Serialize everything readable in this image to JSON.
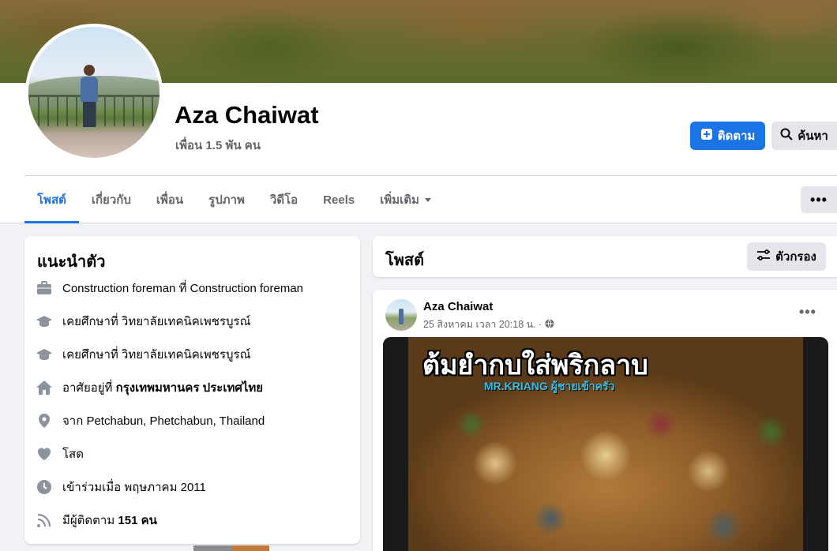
{
  "profile": {
    "name": "Aza Chaiwat",
    "friends": "เพื่อน 1.5 พัน คน"
  },
  "actions": {
    "follow_label": "ติดตาม",
    "search_label": "ค้นหา",
    "more_label": "•••"
  },
  "tabs": [
    {
      "label": "โพสต์",
      "active": true
    },
    {
      "label": "เกี่ยวกับ",
      "active": false
    },
    {
      "label": "เพื่อน",
      "active": false
    },
    {
      "label": "รูปภาพ",
      "active": false
    },
    {
      "label": "วิดีโอ",
      "active": false
    },
    {
      "label": "Reels",
      "active": false
    },
    {
      "label": "เพิ่มเติม",
      "active": false
    }
  ],
  "intro": {
    "title": "แนะนำตัว",
    "items": [
      {
        "icon": "briefcase-icon",
        "text": "Construction foreman ที่ Construction foreman",
        "bold": ""
      },
      {
        "icon": "graduation-cap-icon",
        "text": "เคยศึกษาที่ วิทยาลัยเทคนิคเพชรบูรณ์",
        "bold": ""
      },
      {
        "icon": "graduation-cap-icon",
        "text": "เคยศึกษาที่ วิทยาลัยเทคนิคเพชรบูรณ์",
        "bold": ""
      },
      {
        "icon": "home-icon",
        "text": "อาศัยอยู่ที่ ",
        "bold": "กรุงเทพมหานคร ประเทศไทย"
      },
      {
        "icon": "location-pin-icon",
        "text": "จาก Petchabun, Phetchabun, Thailand",
        "bold": ""
      },
      {
        "icon": "heart-icon",
        "text": "โสด",
        "bold": ""
      },
      {
        "icon": "clock-icon",
        "text": "เข้าร่วมเมื่อ พฤษภาคม 2011",
        "bold": ""
      },
      {
        "icon": "rss-icon",
        "text": "มีผู้ติดตาม ",
        "bold": "151 คน"
      }
    ]
  },
  "posts": {
    "title": "โพสต์",
    "filter_label": "ตัวกรอง"
  },
  "post": {
    "author": "Aza Chaiwat",
    "time": "25 สิงหาคม เวลา 20:18 น. ·",
    "image_title": "ต้มยำกบใส่พริกลาบ",
    "image_subtitle": "MR.KRIANG ผู้ชายเข้าครัว"
  },
  "colors": {
    "accent": "#1b74e4",
    "background": "#f0f2f5",
    "icon_gray": "#65676b"
  }
}
